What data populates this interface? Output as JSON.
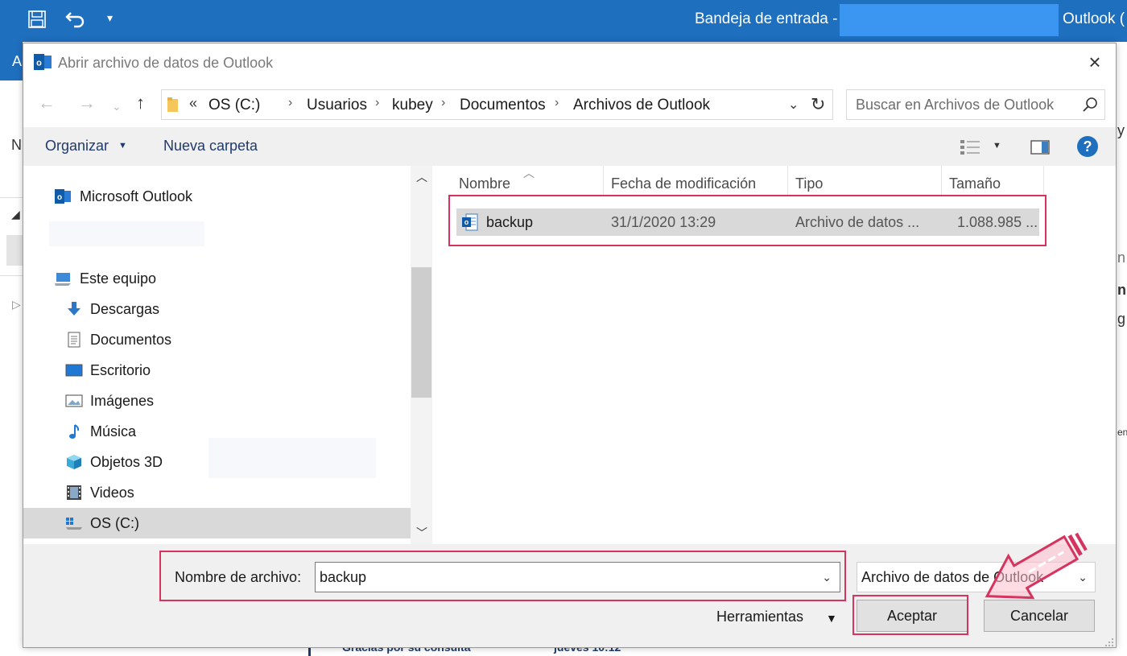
{
  "outlook": {
    "title": "Bandeja de entrada -",
    "title_suffix": "Outlook (",
    "ribbon_letter": "A",
    "frag_n": "N",
    "frag_y": "y",
    "frag_n2": "n",
    "frag_bold_n": "n",
    "frag_g": "g",
    "frag_en": "en",
    "email_preview": "Gracias por su consulta",
    "email_date": "jueves 10:12"
  },
  "dialog": {
    "title": "Abrir archivo de datos de Outlook",
    "close_icon": "×"
  },
  "address_bar": {
    "overflow": "«",
    "breadcrumbs": [
      "OS (C:)",
      "Usuarios",
      "kubey",
      "Documentos",
      "Archivos de Outlook"
    ],
    "separator": "›"
  },
  "search": {
    "placeholder": "Buscar en Archivos de Outlook"
  },
  "toolbar": {
    "organize_label": "Organizar",
    "new_folder_label": "Nueva carpeta",
    "help_label": "?"
  },
  "nav_pane": {
    "items": [
      {
        "label": "Microsoft Outlook",
        "icon": "outlook-icon"
      },
      {
        "label": "Este equipo",
        "icon": "computer-icon"
      },
      {
        "label": "Descargas",
        "icon": "download-icon"
      },
      {
        "label": "Documentos",
        "icon": "documents-icon"
      },
      {
        "label": "Escritorio",
        "icon": "desktop-icon"
      },
      {
        "label": "Imágenes",
        "icon": "pictures-icon"
      },
      {
        "label": "Música",
        "icon": "music-icon"
      },
      {
        "label": "Objetos 3D",
        "icon": "objects-3d-icon"
      },
      {
        "label": "Videos",
        "icon": "videos-icon"
      },
      {
        "label": "OS (C:)",
        "icon": "drive-icon"
      }
    ],
    "selected": "OS (C:)"
  },
  "file_list": {
    "columns": [
      "Nombre",
      "Fecha de modificación",
      "Tipo",
      "Tamaño"
    ],
    "rows": [
      {
        "name": "backup",
        "modified": "31/1/2020 13:29",
        "type": "Archivo de datos ...",
        "size": "1.088.985 ..."
      }
    ]
  },
  "footer": {
    "filename_label": "Nombre de archivo:",
    "filename_value": "backup",
    "filetype_value": "Archivo de datos de Outlook",
    "tools_label": "Herramientas",
    "accept_label": "Aceptar",
    "cancel_label": "Cancelar"
  },
  "colors": {
    "outlook_blue": "#1f6fbf",
    "annotation_red": "#d6335f",
    "selection_gray": "#d9d9d9"
  }
}
